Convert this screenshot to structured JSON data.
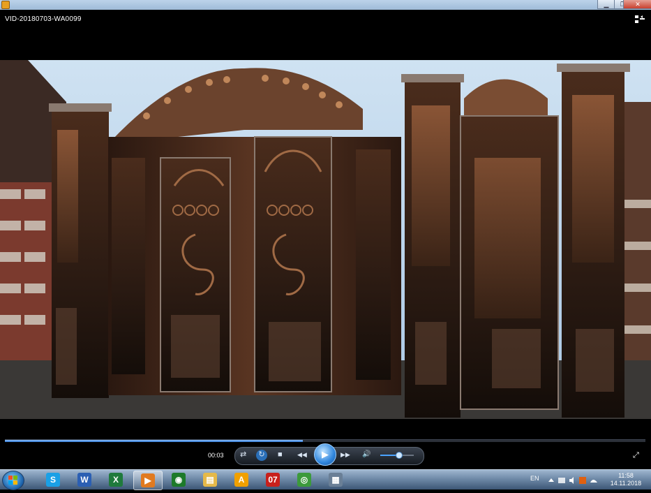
{
  "window": {
    "title": "VID-20180703-WA0099",
    "min_label": "▁",
    "max_label": "❐",
    "close_label": "✕"
  },
  "player": {
    "elapsed": "00:03",
    "progress_fraction": 0.465,
    "volume_fraction": 0.55,
    "buttons": {
      "shuffle": "⇄",
      "repeat": "↻",
      "stop": "■",
      "prev": "◀◀",
      "play": "▶",
      "next": "▶▶",
      "mute": "🔊",
      "fullscreen": "⤢"
    }
  },
  "taskbar": {
    "apps": [
      {
        "icon": "skype-icon",
        "label": "S",
        "color": "#1aa0e6"
      },
      {
        "icon": "word-icon",
        "label": "W",
        "color": "#2b5fb3"
      },
      {
        "icon": "excel-icon",
        "label": "X",
        "color": "#1f7a3c"
      },
      {
        "icon": "media-player-icon",
        "label": "▶",
        "color": "#e07a20"
      },
      {
        "icon": "eye-app-icon",
        "label": "◉",
        "color": "#1d7a2a"
      },
      {
        "icon": "folder-icon",
        "label": "▤",
        "color": "#e5b94a"
      },
      {
        "icon": "aimp-icon",
        "label": "A",
        "color": "#f0a000"
      },
      {
        "icon": "calendar-app-icon",
        "label": "07",
        "color": "#c8201c"
      },
      {
        "icon": "chrome-icon",
        "label": "◎",
        "color": "#3c9a3c"
      },
      {
        "icon": "calculator-icon",
        "label": "▦",
        "color": "#6a7f96"
      }
    ],
    "tray": {
      "language": "EN",
      "time": "11:58",
      "date": "14.11.2018"
    }
  },
  "colors": {
    "accent": "#2f86de",
    "player_bg": "#000000",
    "gate_metal": "#5a3522"
  }
}
